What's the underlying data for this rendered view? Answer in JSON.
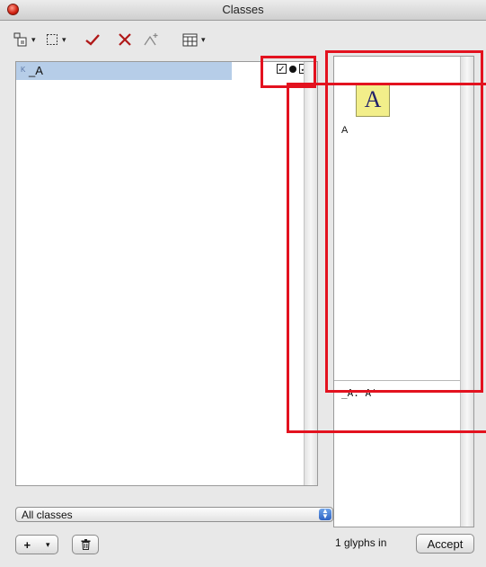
{
  "window": {
    "title": "Classes"
  },
  "toolbar": {
    "tools": [
      {
        "icon": "add-class-icon",
        "dropdown": true
      },
      {
        "icon": "selection-rect-icon",
        "dropdown": true
      },
      {
        "icon": "checkmark-icon",
        "dropdown": false
      },
      {
        "icon": "delete-x-icon",
        "dropdown": false
      },
      {
        "icon": "compile-sparkle-icon",
        "dropdown": false
      },
      {
        "icon": "table-view-icon",
        "dropdown": true
      }
    ],
    "dropdown_glyph": "▾"
  },
  "class_list": {
    "rows": [
      {
        "kind_glyph": "K",
        "name": "_A",
        "checked_a": true,
        "dot": true,
        "checked_b": true
      }
    ]
  },
  "preview": {
    "glyph": "A",
    "glyph_label": "A",
    "feature_code": "_A: A'"
  },
  "filter": {
    "selected": "All classes"
  },
  "buttons": {
    "add": "+",
    "add_dropdown": "▾",
    "delete_icon": "trash-icon",
    "accept": "Accept"
  },
  "status": {
    "text": "1 glyphs in"
  },
  "colors": {
    "selection": "#b6cde8",
    "highlight": "#e3121f",
    "glyph_bg": "#f2ee8a"
  }
}
